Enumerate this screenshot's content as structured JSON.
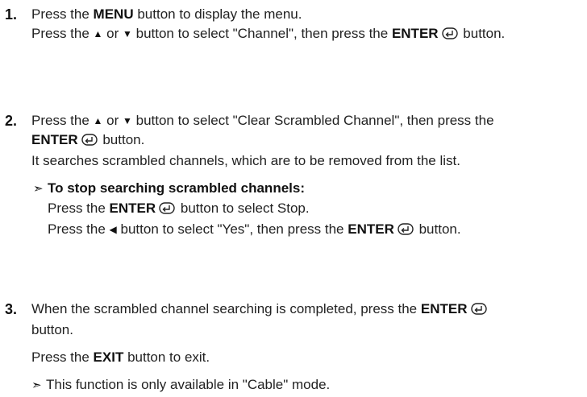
{
  "step1": {
    "number": "1.",
    "l1_a": "Press the ",
    "l1_b": "MENU",
    "l1_c": " button to display the menu.",
    "l2_a": "Press the ",
    "l2_up": "▲",
    "l2_or": " or ",
    "l2_down": "▼",
    "l2_b": " button to select \"Channel\", then press the ",
    "l2_enter": "ENTER",
    "l2_c": " button."
  },
  "step2": {
    "number": "2.",
    "l1_a": "Press the ",
    "l1_up": "▲",
    "l1_or": " or ",
    "l1_down": "▼",
    "l1_b": " button to select \"Clear Scrambled Channel\", then press the",
    "l2_enter": "ENTER",
    "l2_c": " button.",
    "l3": "It searches scrambled channels, which are to be removed from the list.",
    "note_arrow": "➣",
    "note_title": "To stop searching scrambled channels:",
    "n1_a": "Press the ",
    "n1_enter": "ENTER",
    "n1_b": " button to select Stop.",
    "n2_a": "Press the ",
    "n2_left": "◀",
    "n2_b": " button to select \"Yes\", then press the ",
    "n2_enter": "ENTER",
    "n2_c": " button."
  },
  "step3": {
    "number": "3.",
    "l1_a": "When the scrambled channel searching is completed, press the ",
    "l1_enter": "ENTER",
    "l2": "button.",
    "l3_a": "Press the ",
    "l3_exit": "EXIT",
    "l3_b": " button to exit.",
    "note_arrow": "➣",
    "note_text": "This function is only available in \"Cable\" mode."
  },
  "icons": {
    "enter": "enter-icon",
    "up": "up-triangle-icon",
    "down": "down-triangle-icon",
    "left": "left-triangle-icon",
    "note": "note-arrow-icon"
  }
}
